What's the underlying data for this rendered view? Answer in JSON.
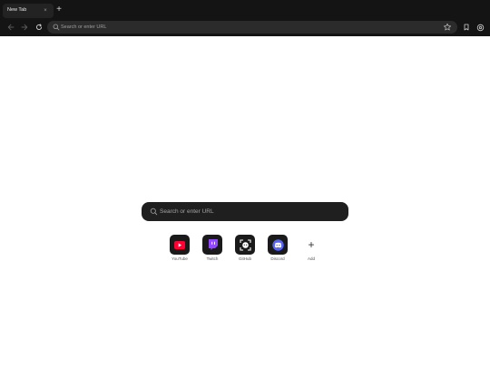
{
  "tabs": [
    {
      "title": "New Tab",
      "close": "×"
    }
  ],
  "new_tab_symbol": "+",
  "toolbar": {
    "url_placeholder": "Search or enter URL"
  },
  "new_tab_page": {
    "search_placeholder": "Search or enter URL",
    "shortcuts": [
      {
        "label": "YouTube",
        "icon": "youtube-icon",
        "color": "#ff0033"
      },
      {
        "label": "Twitch",
        "icon": "twitch-icon",
        "color": "#9146ff"
      },
      {
        "label": "GitHub",
        "icon": "github-icon",
        "color": "#ffffff"
      },
      {
        "label": "Discord",
        "icon": "discord-icon",
        "color": "#5865f2"
      },
      {
        "label": "Add",
        "icon": "plus-icon",
        "symbol": "+"
      }
    ]
  },
  "colors": {
    "chrome_bg": "#141414",
    "urlbar_bg": "#2b2b2b",
    "page_bg": "#ffffff",
    "search_bg": "#1f1f1f"
  }
}
